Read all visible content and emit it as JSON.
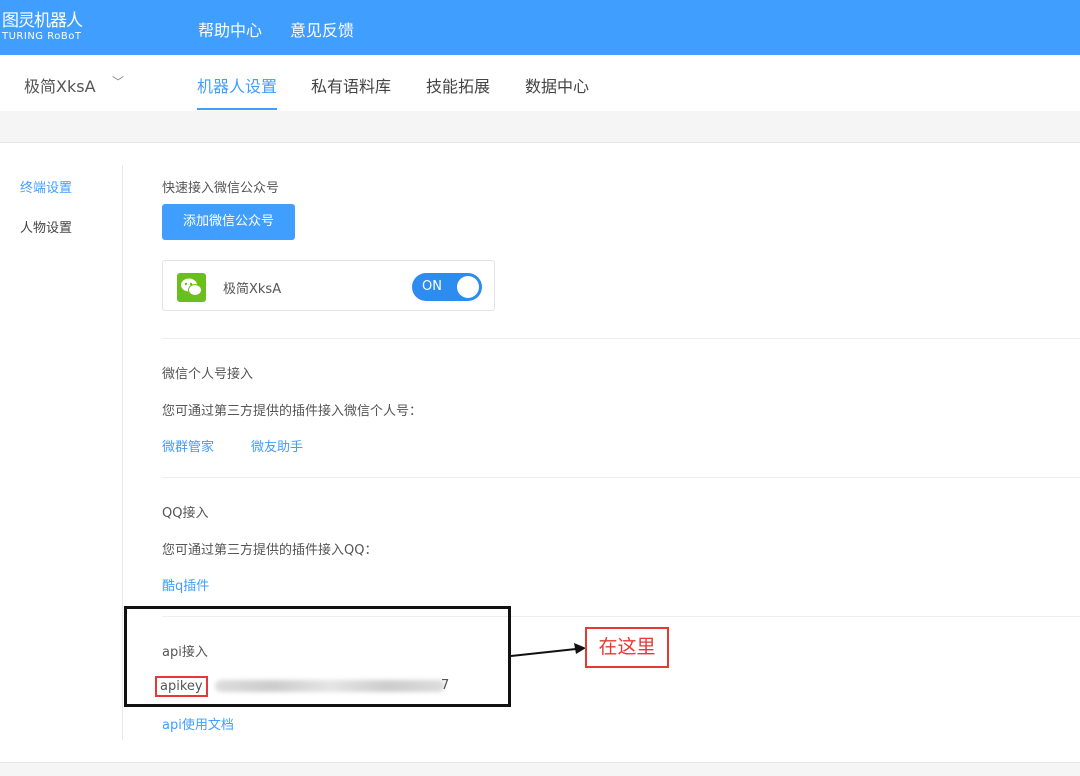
{
  "header": {
    "logo_cn": "图灵机器人",
    "logo_en": "TURING RoBoT",
    "nav": [
      "帮助中心",
      "意见反馈"
    ]
  },
  "subnav": {
    "robot": "极简XksA",
    "tabs": [
      "机器人设置",
      "私有语料库",
      "技能拓展",
      "数据中心"
    ],
    "active_tab": 0
  },
  "sidebar": {
    "items": [
      "终端设置",
      "人物设置"
    ],
    "active": 0
  },
  "wechat_official": {
    "title": "快速接入微信公众号",
    "add_button": "添加微信公众号",
    "account_name": "极简XksA",
    "toggle_label": "ON",
    "toggle_on": true
  },
  "wechat_personal": {
    "title": "微信个人号接入",
    "desc": "您可通过第三方提供的插件接入微信个人号：",
    "links": [
      "微群管家",
      "微友助手"
    ]
  },
  "qq": {
    "title": "QQ接入",
    "desc": "您可通过第三方提供的插件接入QQ：",
    "link": "酷q插件"
  },
  "api": {
    "title": "api接入",
    "key_label": "apikey",
    "key_visible_tail": "7",
    "doc_link": "api使用文档"
  },
  "annotation": {
    "text": "在这里",
    "color": "#e53935"
  },
  "colors": {
    "primary": "#409eff",
    "wechat": "#6bbf1c"
  }
}
